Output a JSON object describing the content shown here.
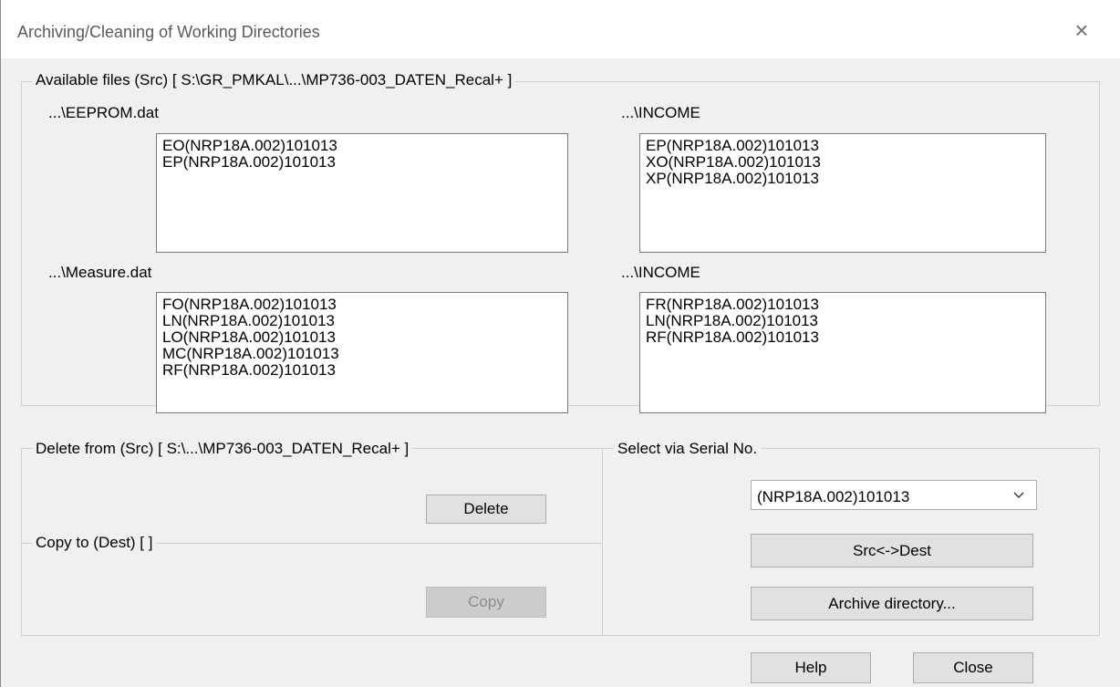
{
  "window": {
    "title": "Archiving/Cleaning of Working Directories",
    "close_glyph": "×"
  },
  "available": {
    "legend": "Available files (Src) [ S:\\GR_PMKAL\\...\\MP736-003_DATEN_Recal+ ]",
    "lists": [
      {
        "label": "...\\EEPROM.dat",
        "items": [
          "EO(NRP18A.002)101013",
          "EP(NRP18A.002)101013"
        ]
      },
      {
        "label": "...\\INCOME",
        "items": [
          "EP(NRP18A.002)101013",
          "XO(NRP18A.002)101013",
          "XP(NRP18A.002)101013"
        ]
      },
      {
        "label": "...\\Measure.dat",
        "items": [
          "FO(NRP18A.002)101013",
          "LN(NRP18A.002)101013",
          "LO(NRP18A.002)101013",
          "MC(NRP18A.002)101013",
          "RF(NRP18A.002)101013"
        ]
      },
      {
        "label": "...\\INCOME",
        "items": [
          "FR(NRP18A.002)101013",
          "LN(NRP18A.002)101013",
          "RF(NRP18A.002)101013"
        ]
      }
    ]
  },
  "delete_group": {
    "legend": "Delete from (Src) [ S:\\...\\MP736-003_DATEN_Recal+ ]",
    "button": "Delete"
  },
  "copy_group": {
    "legend": "Copy to (Dest) [  ]",
    "button": "Copy"
  },
  "serial_group": {
    "legend": "Select via Serial No.",
    "selected": "(NRP18A.002)101013",
    "swap_button": "Src<->Dest",
    "archive_button": "Archive directory..."
  },
  "footer": {
    "help": "Help",
    "close": "Close"
  }
}
